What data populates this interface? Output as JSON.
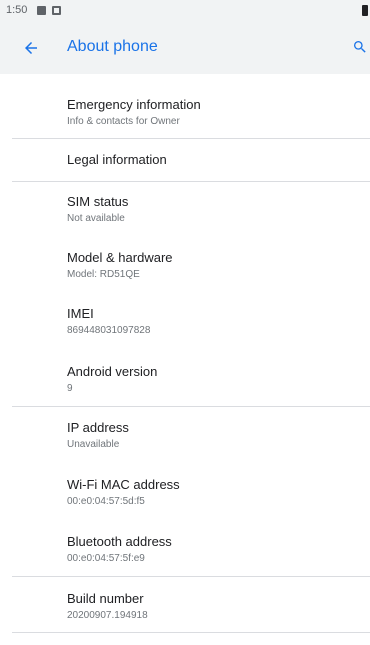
{
  "status_bar": {
    "time": "1:50"
  },
  "app_bar": {
    "title": "About phone",
    "back_icon": "arrow-back-icon",
    "search_icon": "search-icon"
  },
  "items": [
    {
      "title": "Emergency information",
      "subtitle": "Info & contacts for Owner"
    },
    {
      "title": "Legal information",
      "subtitle": ""
    },
    {
      "title": "SIM status",
      "subtitle": "Not available"
    },
    {
      "title": "Model & hardware",
      "subtitle": "Model: RD51QE"
    },
    {
      "title": "IMEI",
      "subtitle": "869448031097828"
    },
    {
      "title": "Android version",
      "subtitle": "9"
    },
    {
      "title": "IP address",
      "subtitle": "Unavailable"
    },
    {
      "title": "Wi-Fi MAC address",
      "subtitle": "00:e0:04:57:5d:f5"
    },
    {
      "title": "Bluetooth address",
      "subtitle": "00:e0:04:57:5f:e9"
    },
    {
      "title": "Build number",
      "subtitle": "20200907.194918"
    }
  ],
  "colors": {
    "accent": "#1a73e8",
    "bar_background": "#f1f3f4",
    "divider": "#dadce0"
  }
}
